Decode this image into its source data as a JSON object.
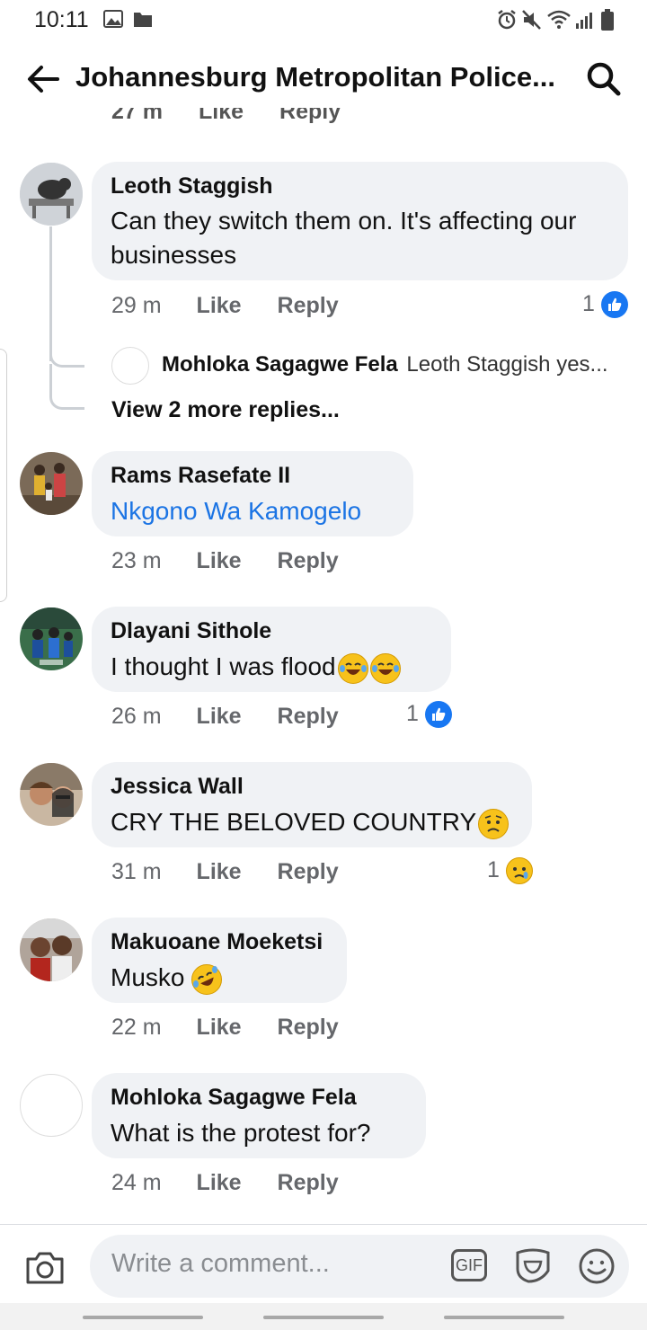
{
  "status_bar": {
    "time": "10:11"
  },
  "header": {
    "title": "Johannesburg Metropolitan Police..."
  },
  "partial_row": {
    "time": "27 m",
    "like": "Like",
    "reply": "Reply"
  },
  "comments": [
    {
      "name": "Leoth Staggish",
      "text": "Can they switch them on. It's affecting our businesses",
      "time": "29 m",
      "like": "Like",
      "reply": "Reply",
      "reaction_count": "1",
      "reaction": "like-icon"
    },
    {
      "name": "Rams Rasefate II",
      "text": "Nkgono Wa Kamogelo",
      "time": "23 m",
      "like": "Like",
      "reply": "Reply"
    },
    {
      "name": "Dlayani Sithole",
      "text": "I thought I was flood",
      "time": "26 m",
      "like": "Like",
      "reply": "Reply",
      "reaction_count": "1",
      "reaction": "like-icon"
    },
    {
      "name": "Jessica Wall",
      "text": "CRY THE BELOVED COUNTRY",
      "time": "31 m",
      "like": "Like",
      "reply": "Reply",
      "reaction_count": "1",
      "reaction": "sad-icon"
    },
    {
      "name": "Makuoane Moeketsi",
      "text": "Musko",
      "time": "22 m",
      "like": "Like",
      "reply": "Reply"
    },
    {
      "name": "Mohloka Sagagwe Fela",
      "text": "What is the protest for?",
      "time": "24 m",
      "like": "Like",
      "reply": "Reply"
    }
  ],
  "nested_reply": {
    "name": "Mohloka Sagagwe Fela",
    "preview": "Leoth Staggish yes..."
  },
  "view_more": "View 2 more replies...",
  "composer": {
    "placeholder": "Write a comment...",
    "gif_label": "GIF"
  },
  "colors": {
    "accent": "#1877f2",
    "link": "#1b74e4",
    "bubble": "#f0f2f5",
    "meta": "#65676b"
  }
}
